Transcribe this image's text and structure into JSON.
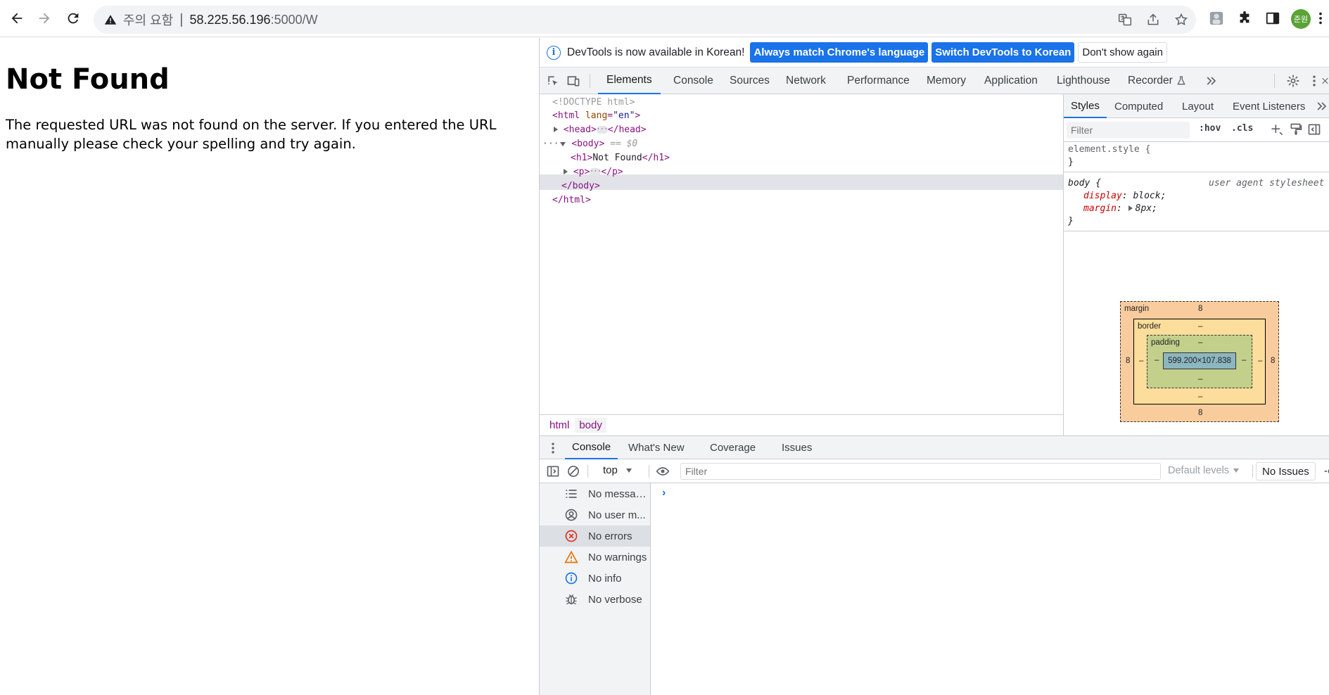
{
  "browser": {
    "security_label": "주의 요함",
    "url_host": "58.225.56.196",
    "url_path": ":5000/W",
    "profile_initials": "준원"
  },
  "page": {
    "heading": "Not Found",
    "body_text": "The requested URL was not found on the server. If you entered the URL manually please check your spelling and try again."
  },
  "devtools": {
    "infobar": {
      "message": "DevTools is now available in Korean!",
      "btn_match": "Always match Chrome's language",
      "btn_switch": "Switch DevTools to Korean",
      "btn_dismiss": "Don't show again"
    },
    "tabs": [
      "Elements",
      "Console",
      "Sources",
      "Network",
      "Performance",
      "Memory",
      "Application",
      "Lighthouse",
      "Recorder"
    ],
    "dom": {
      "doctype": "<!DOCTYPE html>",
      "html_open": "<html",
      "lang_attr": "lang",
      "lang_val": "\"en\"",
      "head_open": "<head>",
      "head_close": "</head>",
      "body_open": "<body>",
      "body_selected": "== $0",
      "h1_open": "<h1>",
      "h1_text": "Not Found",
      "h1_close": "</h1>",
      "p_open": "<p>",
      "p_close": "</p>",
      "body_close": "</body>",
      "html_close": "</html>"
    },
    "breadcrumbs": [
      "html",
      "body"
    ],
    "styles_tabs": [
      "Styles",
      "Computed",
      "Layout",
      "Event Listeners"
    ],
    "styles_filter_placeholder": "Filter",
    "hov_label": ":hov",
    "cls_label": ".cls",
    "element_style": "element.style {",
    "rule_close": "}",
    "body_rule": {
      "selector": "body {",
      "source": "user agent stylesheet",
      "prop1_name": "display",
      "prop1_value": "block;",
      "prop2_name": "margin",
      "prop2_value": "8px;"
    },
    "box_model": {
      "margin_label": "margin",
      "border_label": "border",
      "padding_label": "padding",
      "margin_top": "8",
      "margin_bottom": "8",
      "margin_left": "8",
      "margin_right": "8",
      "border_top": "–",
      "border_bottom": "–",
      "border_left": "–",
      "border_right": "–",
      "padding_top": "–",
      "padding_bottom": "–",
      "padding_left": "–",
      "padding_right": "–",
      "content": "599.200×107.838"
    },
    "drawer_tabs": [
      "Console",
      "What's New",
      "Coverage",
      "Issues"
    ],
    "console": {
      "context": "top",
      "filter_placeholder": "Filter",
      "levels": "Default levels",
      "issues": "No Issues",
      "sidebar": [
        {
          "label": "No messag...",
          "icon": "list-icon"
        },
        {
          "label": "No user m...",
          "icon": "user-icon"
        },
        {
          "label": "No errors",
          "icon": "error-icon"
        },
        {
          "label": "No warnings",
          "icon": "warning-icon"
        },
        {
          "label": "No info",
          "icon": "info-icon"
        },
        {
          "label": "No verbose",
          "icon": "bug-icon"
        }
      ],
      "prompt": "›"
    }
  },
  "colors": {
    "accent": "#1a73e8",
    "tag": "#881280",
    "error": "#d93025",
    "warning": "#e37400"
  }
}
